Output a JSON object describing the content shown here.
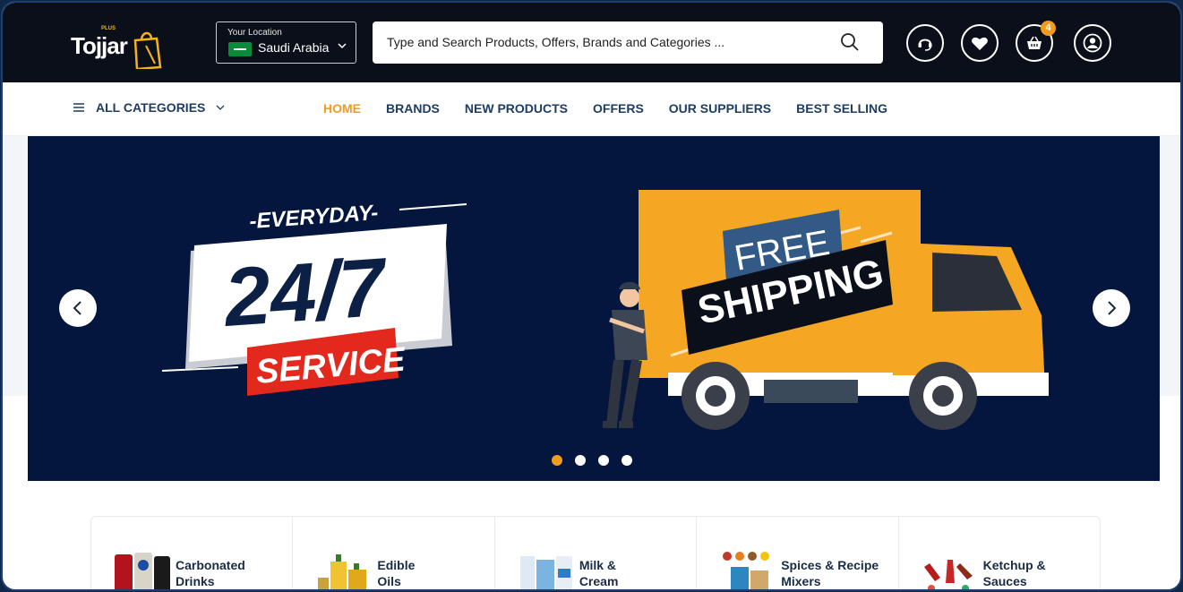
{
  "header": {
    "logo_text": "Tojjar",
    "logo_plus": "PLUS",
    "location_label": "Your Location",
    "location_value": "Saudi Arabia",
    "search_placeholder": "Type and Search Products, Offers, Brands and Categories ...",
    "cart_count": "4",
    "icons": [
      "support-icon",
      "heart-icon",
      "cart-icon",
      "user-icon"
    ]
  },
  "nav": {
    "all_categories": "ALL CATEGORIES",
    "links": [
      {
        "label": "HOME",
        "active": true
      },
      {
        "label": "BRANDS",
        "active": false
      },
      {
        "label": "NEW PRODUCTS",
        "active": false
      },
      {
        "label": "OFFERS",
        "active": false
      },
      {
        "label": "OUR SUPPLIERS",
        "active": false
      },
      {
        "label": "BEST SELLING",
        "active": false
      }
    ]
  },
  "banner": {
    "everyday": "-EVERYDAY-",
    "big": "24/7",
    "service": "SERVICE",
    "free": "FREE",
    "shipping": "SHIPPING",
    "slide_count": 4,
    "active_slide": 1
  },
  "categories": [
    {
      "line1": "Carbonated",
      "line2": "Drinks"
    },
    {
      "line1": "Edible",
      "line2": "Oils"
    },
    {
      "line1": "Milk &",
      "line2": "Cream"
    },
    {
      "line1": "Spices & Recipe",
      "line2": "Mixers"
    },
    {
      "line1": "Ketchup &",
      "line2": "Sauces"
    }
  ],
  "colors": {
    "topbar": "#0b0f19",
    "accent": "#f29c1f",
    "nav_text": "#1f3d63",
    "banner_bg": "#04163d",
    "truck": "#f5a623",
    "service_red": "#e3281d"
  }
}
